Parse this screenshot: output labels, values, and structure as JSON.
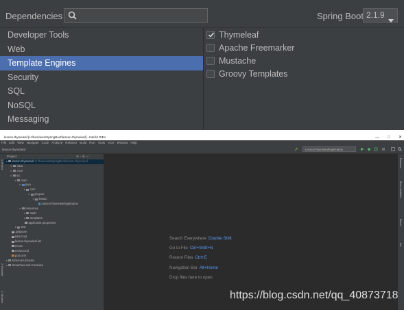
{
  "dependencies_panel": {
    "title": "Dependencies",
    "search_value": "",
    "spring_boot_label": "Spring Boot",
    "spring_boot_version": "2.1.9",
    "categories": [
      {
        "label": "Developer Tools",
        "selected": false
      },
      {
        "label": "Web",
        "selected": false
      },
      {
        "label": "Template Engines",
        "selected": true
      },
      {
        "label": "Security",
        "selected": false
      },
      {
        "label": "SQL",
        "selected": false
      },
      {
        "label": "NoSQL",
        "selected": false
      },
      {
        "label": "Messaging",
        "selected": false
      }
    ],
    "dependencies": [
      {
        "label": "Thymeleaf",
        "checked": true
      },
      {
        "label": "Apache Freemarker",
        "checked": false
      },
      {
        "label": "Mustache",
        "checked": false
      },
      {
        "label": "Groovy Templates",
        "checked": false
      }
    ]
  },
  "ide": {
    "window_title": "lesson-thymeleaf [H:\\business\\SpringBoot\\lesson-thymeleaf] - IntelliJ IDEA",
    "window_controls": [
      "—",
      "□",
      "✕"
    ],
    "menu": [
      "File",
      "Edit",
      "View",
      "Navigate",
      "Code",
      "Analyze",
      "Refactor",
      "Build",
      "Run",
      "Tools",
      "VCS",
      "Window",
      "Help"
    ],
    "breadcrumb": "lesson-thymeleaf",
    "run_config": "LessonThymeleafApplication",
    "project_header": "Project",
    "left_tabs": [
      "1: Project",
      "2: Favorites",
      "Z: Structure"
    ],
    "right_tabs": [
      "Database",
      "Bean Validation",
      "Maven",
      "Ant"
    ],
    "tree": [
      {
        "indent": 0,
        "label": "lesson-thymeleaf",
        "dim": "H:\\business\\SpringBoot\\lesson-thymeleaf",
        "icon": "folder",
        "selected": true
      },
      {
        "indent": 1,
        "label": ".idea",
        "icon": "folder"
      },
      {
        "indent": 1,
        "label": ".mvn",
        "icon": "folder"
      },
      {
        "indent": 1,
        "label": "src",
        "icon": "folder"
      },
      {
        "indent": 2,
        "label": "main",
        "icon": "folder"
      },
      {
        "indent": 3,
        "label": "java",
        "icon": "folder-blue"
      },
      {
        "indent": 4,
        "label": "com",
        "icon": "package"
      },
      {
        "indent": 5,
        "label": "yingxue",
        "icon": "package"
      },
      {
        "indent": 6,
        "label": "lesson",
        "icon": "package"
      },
      {
        "indent": 7,
        "label": "LessonThymeleafApplication",
        "icon": "class"
      },
      {
        "indent": 3,
        "label": "resources",
        "icon": "folder"
      },
      {
        "indent": 4,
        "label": "static",
        "icon": "folder"
      },
      {
        "indent": 4,
        "label": "templates",
        "icon": "folder"
      },
      {
        "indent": 4,
        "label": "application.properties",
        "icon": "file"
      },
      {
        "indent": 2,
        "label": "test",
        "icon": "folder"
      },
      {
        "indent": 1,
        "label": ".gitignore",
        "icon": "file"
      },
      {
        "indent": 1,
        "label": "HELP.md",
        "icon": "file"
      },
      {
        "indent": 1,
        "label": "lesson-thymeleaf.iml",
        "icon": "file"
      },
      {
        "indent": 1,
        "label": "mvnw",
        "icon": "file"
      },
      {
        "indent": 1,
        "label": "mvnw.cmd",
        "icon": "file"
      },
      {
        "indent": 1,
        "label": "pom.xml",
        "icon": "maven"
      },
      {
        "indent": 0,
        "label": "External Libraries",
        "icon": "lib"
      },
      {
        "indent": 0,
        "label": "Scratches and Consoles",
        "icon": "scratch"
      }
    ],
    "editor_hints": [
      {
        "action": "Search Everywhere",
        "shortcut": "Double Shift"
      },
      {
        "action": "Go to File",
        "shortcut": "Ctrl+Shift+N"
      },
      {
        "action": "Recent Files",
        "shortcut": "Ctrl+E"
      },
      {
        "action": "Navigation Bar",
        "shortcut": "Alt+Home"
      },
      {
        "action": "Drop files here to open",
        "shortcut": ""
      }
    ]
  },
  "watermark": "https://blog.csdn.net/qq_40873718",
  "colors": {
    "panel_bg": "#3c3f41",
    "selection": "#4b6eaf",
    "editor_bg": "#2b2b2b",
    "shortcut": "#589df6"
  }
}
